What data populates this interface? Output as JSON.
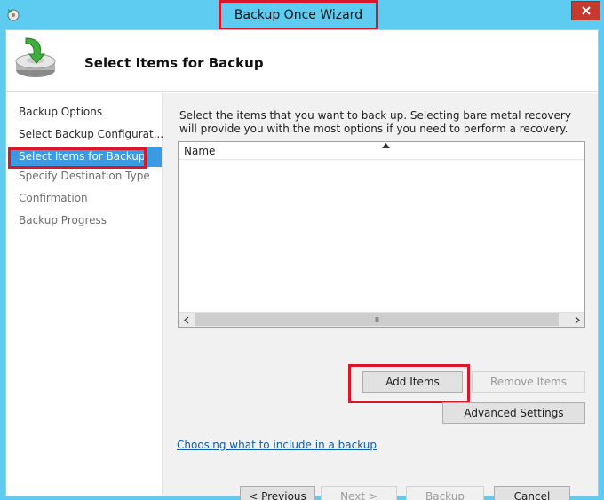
{
  "window": {
    "title": "Backup Once Wizard",
    "close_glyph": "✕"
  },
  "header": {
    "title": "Select Items for Backup",
    "icon": "backup-drive-icon"
  },
  "sidebar": {
    "items": [
      {
        "label": "Backup Options",
        "state": "done"
      },
      {
        "label": "Select Backup Configurat...",
        "state": "done"
      },
      {
        "label": "Select Items for Backup",
        "state": "active"
      },
      {
        "label": "Specify Destination Type",
        "state": "pending"
      },
      {
        "label": "Confirmation",
        "state": "pending"
      },
      {
        "label": "Backup Progress",
        "state": "pending"
      }
    ]
  },
  "main": {
    "instruction": "Select the items that you want to back up. Selecting bare metal recovery will provide you with the most options if you need to perform a recovery.",
    "list": {
      "columns": [
        "Name"
      ],
      "rows": [],
      "scroll_grip": "III"
    },
    "buttons": {
      "add_items": "Add Items",
      "remove_items": "Remove Items",
      "advanced_settings": "Advanced Settings"
    },
    "help_link": "Choosing what to include in a backup"
  },
  "footer": {
    "previous": "< Previous",
    "next": "Next >",
    "backup": "Backup",
    "cancel": "Cancel"
  },
  "colors": {
    "titlebar": "#5ecbf0",
    "highlight": "#d9172a",
    "active_nav": "#3b9ae1",
    "link": "#0f5da8",
    "close": "#c7392d"
  }
}
